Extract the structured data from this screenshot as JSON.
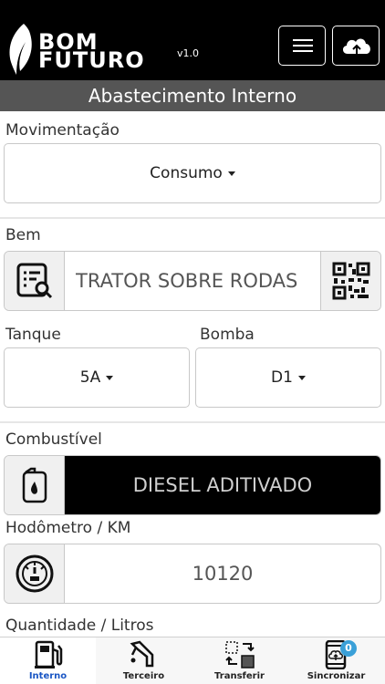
{
  "header": {
    "logo_line1": "BOM",
    "logo_line2": "FUTURO",
    "version": "v1.0",
    "menu_icon": "hamburger-icon",
    "sync_icon": "cloud-upload-icon"
  },
  "title": "Abastecimento Interno",
  "movimentacao": {
    "label": "Movimentação",
    "value": "Consumo"
  },
  "bem": {
    "label": "Bem",
    "value": "TRATOR SOBRE RODAS",
    "left_icon": "list-search-icon",
    "right_icon": "qr-code-icon"
  },
  "tanque": {
    "label": "Tanque",
    "value": "5A"
  },
  "bomba": {
    "label": "Bomba",
    "value": "D1"
  },
  "combustivel": {
    "label": "Combustível",
    "value": "DIESEL ADITIVADO",
    "icon": "fuel-canister-icon",
    "value_bg": "#000000"
  },
  "hodometro": {
    "label": "Hodômetro / KM",
    "value": "10120",
    "icon": "odometer-icon"
  },
  "quantidade": {
    "label": "Quantidade / Litros"
  },
  "tabs": [
    {
      "label": "Interno",
      "icon": "fuel-pump-icon",
      "active": true
    },
    {
      "label": "Terceiro",
      "icon": "fuel-nozzle-icon",
      "active": false
    },
    {
      "label": "Transferir",
      "icon": "transfer-icon",
      "active": false
    },
    {
      "label": "Sincronizar",
      "icon": "phone-sync-icon",
      "active": false,
      "badge": "0"
    }
  ],
  "colors": {
    "header_bg": "#000000",
    "title_bg": "#555555",
    "active_tab": "#1a56c4",
    "badge": "#3aa0d8"
  }
}
